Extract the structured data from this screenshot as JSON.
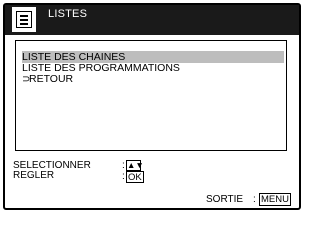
{
  "header": {
    "title": "LISTES",
    "icon": "menu-list-icon"
  },
  "list": {
    "items": [
      {
        "label": "LISTE DES CHAINES",
        "selected": true
      },
      {
        "label": "LISTE DES PROGRAMMATIONS",
        "selected": false
      },
      {
        "label": "RETOUR",
        "selected": false,
        "icon": "return-arrow-icon",
        "icon_glyph": "⊃"
      }
    ]
  },
  "footer": {
    "select_label": "SELECTIONNER",
    "select_sep": ":",
    "select_key": "▲▼",
    "adjust_label": "REGLER",
    "adjust_sep": ":",
    "adjust_key": "OK",
    "exit_label": "SORTIE",
    "exit_sep": ":",
    "exit_key": "MENU"
  },
  "colors": {
    "header_bg": "#1a1a1a",
    "selected_bg": "#bdbdbd"
  }
}
